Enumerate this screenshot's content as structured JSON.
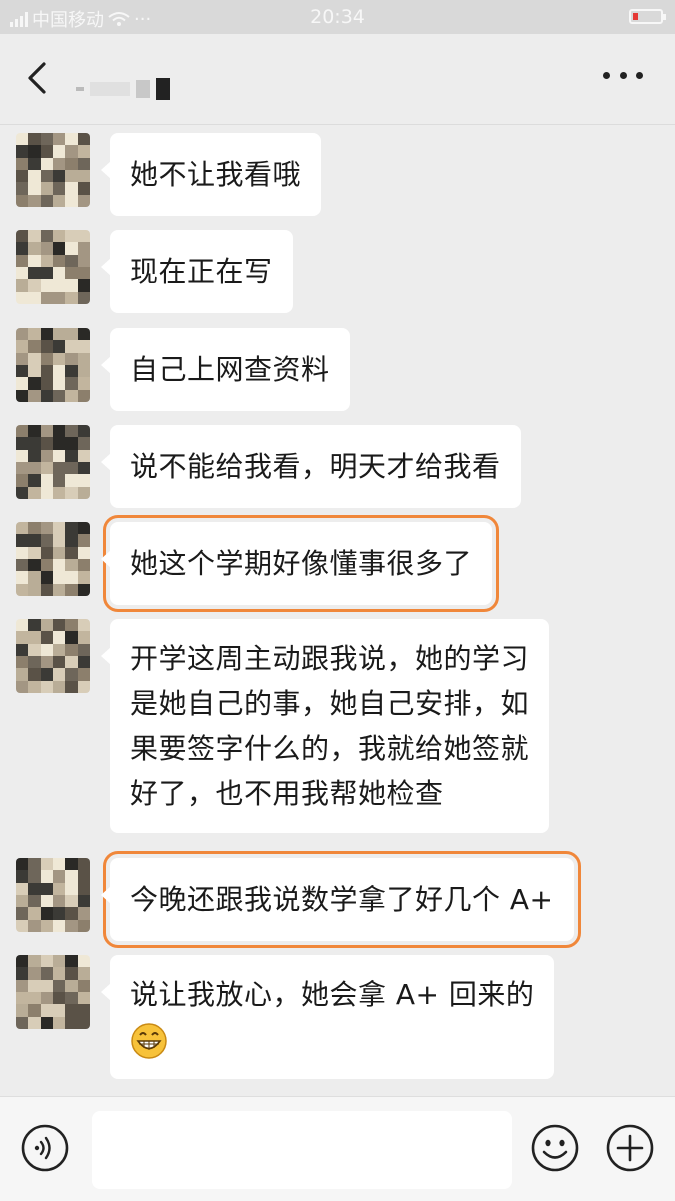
{
  "status_bar": {
    "carrier": "中国移动",
    "dots": "···",
    "time": "20:34",
    "battery_color": "#e53935"
  },
  "nav": {
    "back_icon": "chevron-left-icon",
    "more_icon": "more-dots-icon"
  },
  "messages": [
    {
      "text": "她不让我看哦",
      "highlighted": false
    },
    {
      "text": "现在正在写",
      "highlighted": false
    },
    {
      "text": "自己上网查资料",
      "highlighted": false
    },
    {
      "text": "说不能给我看，明天才给我看",
      "highlighted": false
    },
    {
      "text": "她这个学期好像懂事很多了",
      "highlighted": true
    },
    {
      "lines": [
        "开学这周主动跟我说，她的学习",
        "是她自己的事，她自己安排，如",
        "果要签字什么的，我就给她签就",
        "好了，也不用我帮她检查"
      ],
      "highlighted": false
    },
    {
      "text": "今晚还跟我说数学拿了好几个 A+",
      "highlighted": true
    },
    {
      "text": "说让我放心，她会拿 A+ 回来的",
      "emoji": "grinning-face-icon",
      "highlighted": false
    }
  ],
  "input_bar": {
    "voice_icon": "voice-icon",
    "emoji_icon": "smile-icon",
    "plus_icon": "plus-icon",
    "input_value": ""
  },
  "colors": {
    "highlight_border": "#f0873a",
    "background": "#ededed",
    "bubble": "#ffffff"
  }
}
